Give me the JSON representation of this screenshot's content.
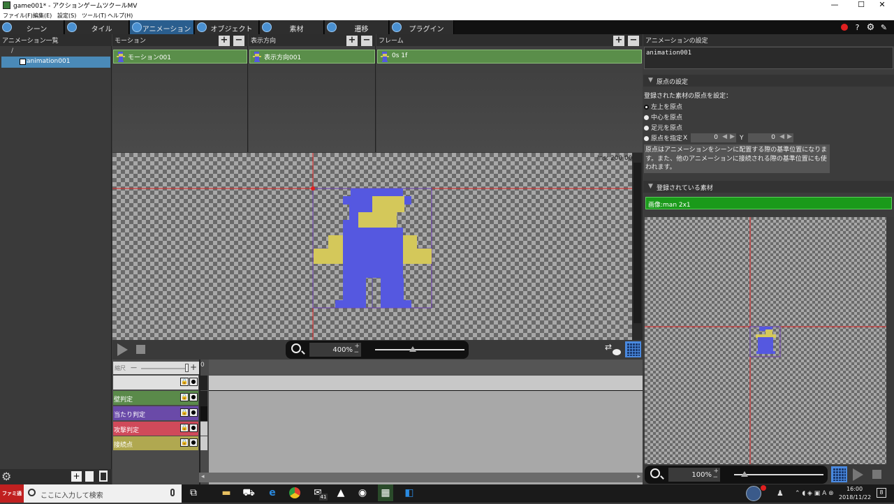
{
  "window": {
    "title": "game001* - アクションゲームツクールMV",
    "controls": [
      "—",
      "☐",
      "✕"
    ]
  },
  "menu": [
    "ファイル(F)",
    "編集(E)",
    "設定(S)",
    "ツール(T)",
    "ヘルプ(H)"
  ],
  "tabs": [
    {
      "label": "シーン",
      "icon": "scene-icon"
    },
    {
      "label": "タイル",
      "icon": "tile-icon"
    },
    {
      "label": "アニメーション",
      "icon": "animation-icon",
      "active": true
    },
    {
      "label": "オブジェクト",
      "icon": "object-icon"
    },
    {
      "label": "素材",
      "icon": "material-icon"
    },
    {
      "label": "遷移",
      "icon": "transition-icon"
    },
    {
      "label": "プラグイン",
      "icon": "plugin-icon"
    }
  ],
  "topright_icons": [
    "record-icon",
    "help-icon",
    "gear-icon",
    "edit-icon"
  ],
  "animation_list": {
    "header": "アニメーション一覧",
    "root": "/",
    "items": [
      "animation001"
    ]
  },
  "motion": {
    "header": "モーション",
    "items": [
      "モーション001"
    ]
  },
  "direction": {
    "header": "表示方向",
    "items": [
      "表示方向001"
    ]
  },
  "frame": {
    "header": "フレーム",
    "items": [
      "0s 1f"
    ]
  },
  "canvas": {
    "fps_text": "Ins: 200 00",
    "zoom": "400%",
    "zoom_level": 0.42
  },
  "timeline": {
    "start_frame": "0",
    "zoom_label": "縮尺",
    "layers": [
      {
        "name": "",
        "color": "#e0e0e0"
      },
      {
        "name": "壁判定",
        "color": "#5a8a4a"
      },
      {
        "name": "当たり判定",
        "color": "#6a4aa8"
      },
      {
        "name": "攻撃判定",
        "color": "#d04a5a"
      },
      {
        "name": "接続点",
        "color": "#b0a850"
      }
    ]
  },
  "settings": {
    "header": "アニメーションの設定",
    "name": "animation001",
    "origin_section": "原点の設定",
    "origin_prompt": "登録された素材の原点を設定：",
    "origin_options": [
      "左上を原点",
      "中心を原点",
      "足元を原点",
      "原点を指定"
    ],
    "origin_selected": 0,
    "x_label": "X",
    "x_value": "0",
    "y_label": "Y",
    "y_value": "0",
    "tooltip": "原点はアニメーションをシーンに配置する際の基準位置になります。また、他のアニメーションに接続される際の基準位置にも使われます。",
    "registered_section": "登録されている素材",
    "registered_item": "画像:man 2x1",
    "preview_zoom": "100%",
    "preview_zoom_level": 0.12
  },
  "taskbar": {
    "search_placeholder": "ここに入力して検索",
    "time": "16:00",
    "date": "2018/11/22",
    "mail_badge": "41",
    "notif_badge": "8",
    "watermark": "ファミ通"
  },
  "colors": {
    "character_blue": "#5558e0",
    "character_yellow": "#d4c85a",
    "guide_red": "#e02020",
    "selection_green": "#1a9a1a"
  }
}
